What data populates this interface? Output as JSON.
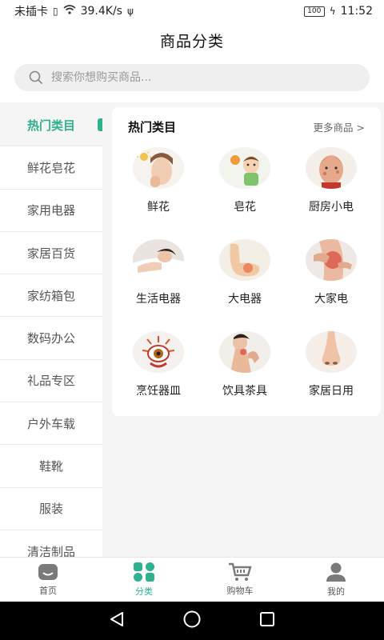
{
  "status_bar": {
    "carrier": "未插卡",
    "speed": "39.4K/s",
    "battery": "100",
    "time": "11:52"
  },
  "header": {
    "title": "商品分类"
  },
  "search": {
    "placeholder": "搜索你想购买商品..."
  },
  "sidebar": {
    "items": [
      {
        "label": "热门类目",
        "active": true
      },
      {
        "label": "鲜花皂花",
        "active": false
      },
      {
        "label": "家用电器",
        "active": false
      },
      {
        "label": "家居百货",
        "active": false
      },
      {
        "label": "家纺箱包",
        "active": false
      },
      {
        "label": "数码办公",
        "active": false
      },
      {
        "label": "礼品专区",
        "active": false
      },
      {
        "label": "户外车载",
        "active": false
      },
      {
        "label": "鞋靴",
        "active": false
      },
      {
        "label": "服装",
        "active": false
      },
      {
        "label": "清洁制品",
        "active": false
      }
    ]
  },
  "panel": {
    "title": "热门类目",
    "more": "更多商品 >",
    "items": [
      {
        "label": "鲜花",
        "icon": "face-sun-image"
      },
      {
        "label": "皂花",
        "icon": "child-sun-image"
      },
      {
        "label": "厨房小电",
        "icon": "man-face-image"
      },
      {
        "label": "生活电器",
        "icon": "woman-lying-image"
      },
      {
        "label": "大电器",
        "icon": "elbow-image"
      },
      {
        "label": "大家电",
        "icon": "knee-image"
      },
      {
        "label": "烹饪器皿",
        "icon": "eye-image"
      },
      {
        "label": "饮具茶具",
        "icon": "woman-neck-image"
      },
      {
        "label": "家居日用",
        "icon": "nose-image"
      }
    ]
  },
  "tabbar": {
    "items": [
      {
        "label": "首页",
        "icon": "home-icon",
        "active": false
      },
      {
        "label": "分类",
        "icon": "category-icon",
        "active": true
      },
      {
        "label": "购物车",
        "icon": "cart-icon",
        "active": false
      },
      {
        "label": "我的",
        "icon": "user-icon",
        "active": false
      }
    ]
  },
  "colors": {
    "accent": "#2fb08f",
    "background": "#f5f5f5"
  }
}
